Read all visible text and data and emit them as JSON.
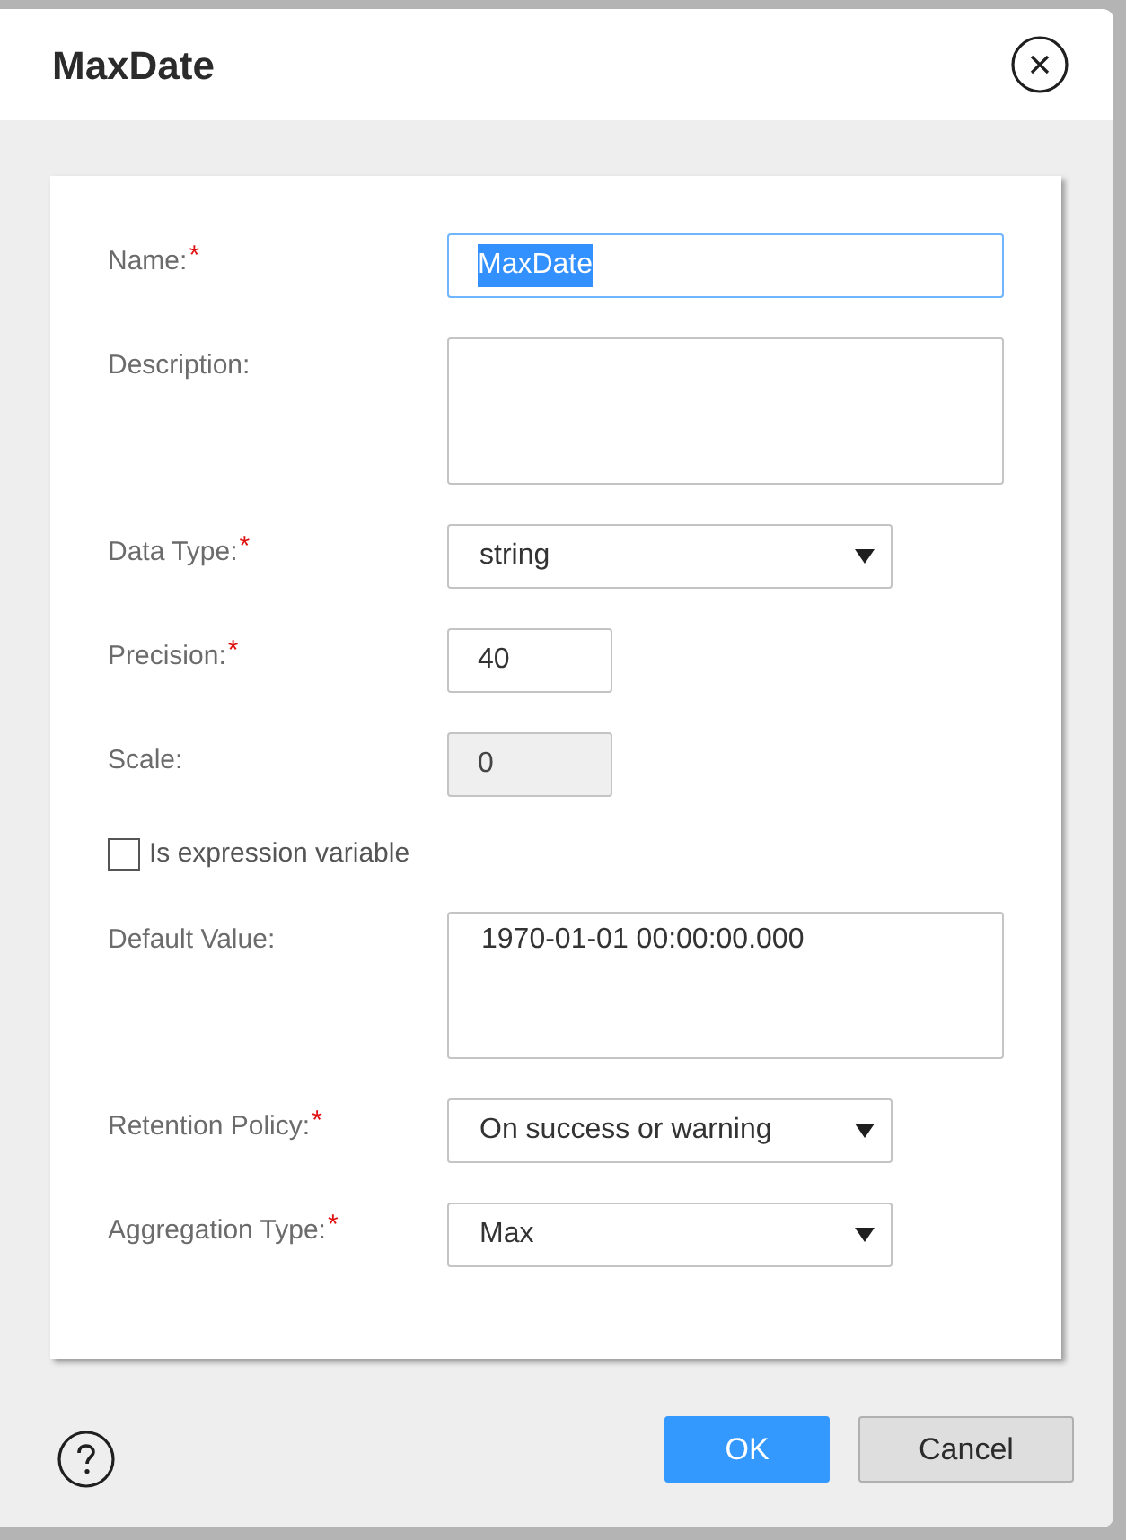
{
  "dialog": {
    "title": "MaxDate"
  },
  "fields": [
    {
      "kind": "text",
      "label": "Name:",
      "marker": "*",
      "value": "MaxDate",
      "focused": true,
      "value_selected": true,
      "disabled": false
    },
    {
      "kind": "textarea",
      "label": "Description:",
      "focused": false,
      "disabled": false
    },
    {
      "kind": "select",
      "label": "Data Type:",
      "marker": "*",
      "value": "string",
      "focused": false,
      "value_selected": false,
      "disabled": false
    },
    {
      "kind": "number",
      "label": "Precision:",
      "marker": "*",
      "value": "40",
      "focused": false,
      "value_selected": false,
      "disabled": false
    },
    {
      "kind": "number",
      "label": "Scale:",
      "value": "0",
      "focused": false,
      "value_selected": false,
      "disabled": true
    },
    {
      "kind": "checkbox",
      "label": "Is expression variable",
      "checked": false
    },
    {
      "kind": "textarea",
      "label": "Default Value:",
      "value": "1970-01-01 00:00:00.000",
      "focused": false,
      "value_selected": false,
      "disabled": false
    },
    {
      "kind": "select",
      "label": "Retention Policy:",
      "marker": "*",
      "value": "On success or warning",
      "focused": false,
      "value_selected": false,
      "disabled": false
    },
    {
      "kind": "select",
      "label": "Aggregation Type:",
      "marker": "*",
      "value": "Max",
      "focused": false,
      "value_selected": false,
      "disabled": false
    }
  ],
  "footer": {
    "buttons": [
      {
        "kind": "primary",
        "label": "OK"
      },
      {
        "kind": "secondary",
        "label": "Cancel"
      }
    ]
  }
}
